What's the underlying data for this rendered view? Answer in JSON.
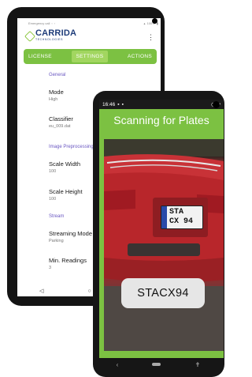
{
  "settings_phone": {
    "status_left": "Emergency call",
    "status_right": "100%",
    "logo": {
      "name": "CARRIDA",
      "sub": "TECHNOLOGIES"
    },
    "tabs": [
      {
        "label": "LICENSE",
        "active": false
      },
      {
        "label": "SETTINGS",
        "active": true
      },
      {
        "label": "ACTIONS",
        "active": false
      }
    ],
    "sections": {
      "general": "General",
      "image_preprocessing": "Image Preprocessing",
      "stream": "Stream"
    },
    "items": {
      "mode": {
        "label": "Mode",
        "value": "High"
      },
      "classifier": {
        "label": "Classifier",
        "value": "eu_009.dat"
      },
      "scale_width": {
        "label": "Scale Width",
        "value": "100"
      },
      "scale_height": {
        "label": "Scale Height",
        "value": "100"
      },
      "streaming_mode": {
        "label": "Streaming Mode",
        "value": "Parking"
      },
      "min_readings": {
        "label": "Min. Readings",
        "value": "3"
      }
    },
    "accent_color": "#7cc142"
  },
  "scanner_phone": {
    "time": "16:46",
    "title": "Scanning for Plates",
    "plate_on_car": {
      "line1": "STA",
      "line2": "CX 94"
    },
    "result": "STACX94",
    "accent_color": "#7cc142"
  }
}
